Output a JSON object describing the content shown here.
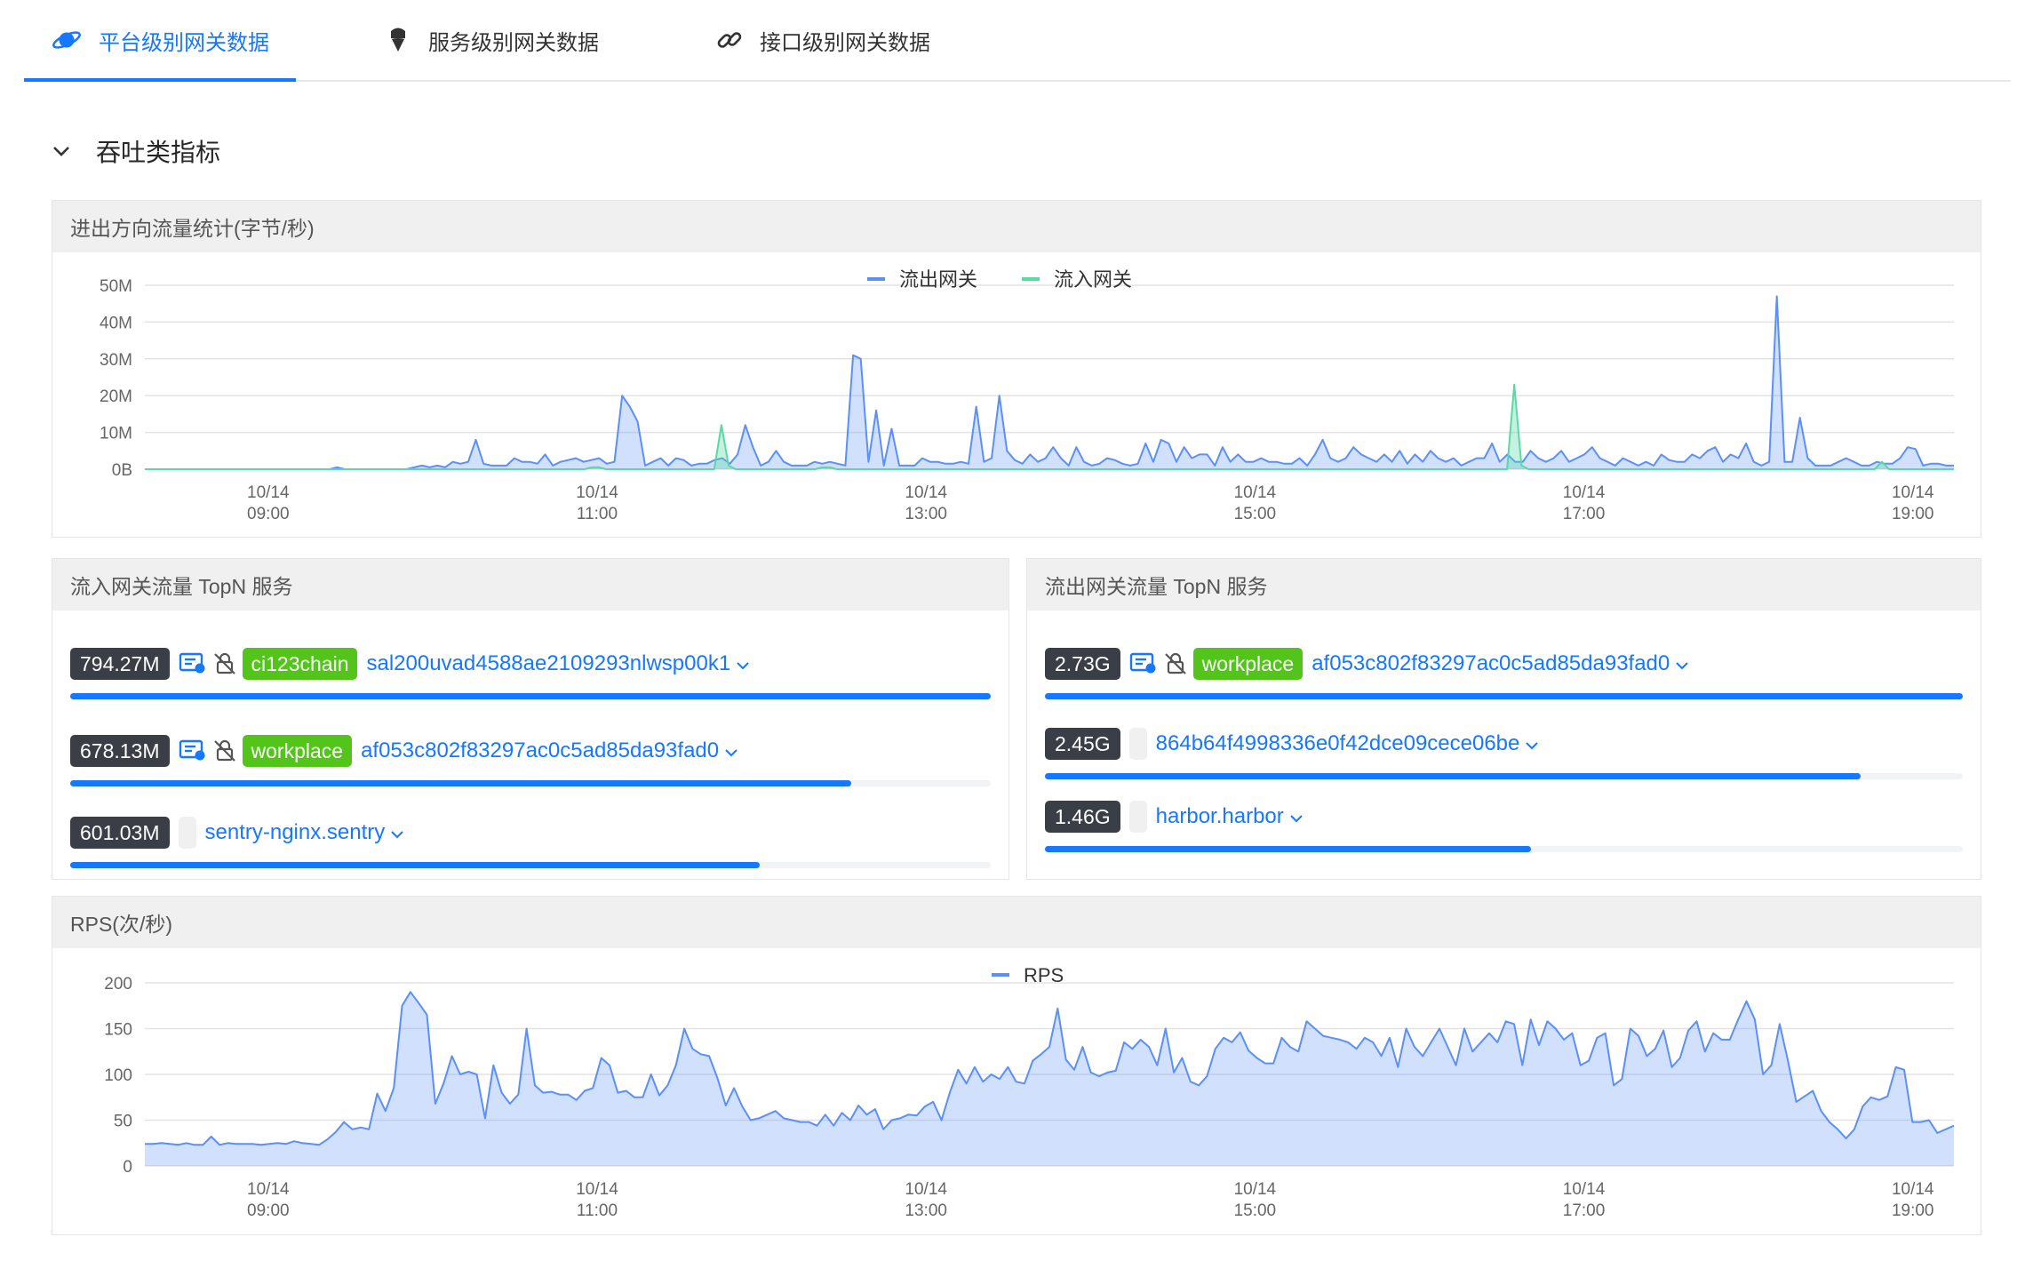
{
  "tabs": [
    {
      "label": "平台级别网关数据",
      "icon": "planet-icon",
      "active": true
    },
    {
      "label": "服务级别网关数据",
      "icon": "ice-cream-icon",
      "active": false
    },
    {
      "label": "接口级别网关数据",
      "icon": "link-icon",
      "active": false
    }
  ],
  "section": {
    "title": "吞吐类指标"
  },
  "colors": {
    "accent": "#1677ff",
    "outflow": "#5b8ff9",
    "inflow": "#5ad8a6",
    "badge_bg": "#3a3f47",
    "env_tag": "#52c41a"
  },
  "traffic_panel": {
    "title": "进出方向流量统计(字节/秒)"
  },
  "in_topn": {
    "title": "流入网关流量 TopN 服务",
    "items": [
      {
        "value": "794.27M",
        "env": "ci123chain",
        "service": "sal200uvad4588ae2109293nlwsp00k1",
        "ratio": 1.0,
        "icons": true
      },
      {
        "value": "678.13M",
        "env": "workplace",
        "service": "af053c802f83297ac0c5ad85da93fad0",
        "ratio": 0.848,
        "icons": true
      },
      {
        "value": "601.03M",
        "env": "",
        "service": "sentry-nginx.sentry",
        "ratio": 0.749,
        "icons": false
      }
    ]
  },
  "out_topn": {
    "title": "流出网关流量 TopN 服务",
    "items": [
      {
        "value": "2.73G",
        "env": "workplace",
        "service": "af053c802f83297ac0c5ad85da93fad0",
        "ratio": 1.0,
        "icons": true
      },
      {
        "value": "2.45G",
        "env": "",
        "service": "864b64f4998336e0f42dce09cece06be",
        "ratio": 0.889,
        "icons": false
      },
      {
        "value": "1.46G",
        "env": "",
        "service": "harbor.harbor",
        "ratio": 0.53,
        "icons": false
      }
    ]
  },
  "rps_panel": {
    "title": "RPS(次/秒)"
  },
  "chart_data": [
    {
      "type": "area",
      "title": "进出方向流量统计(字节/秒)",
      "x_range": [
        "08:15",
        "19:15"
      ],
      "x_ticks": [
        [
          "10/14",
          "09:00"
        ],
        [
          "10/14",
          "11:00"
        ],
        [
          "10/14",
          "13:00"
        ],
        [
          "10/14",
          "15:00"
        ],
        [
          "10/14",
          "17:00"
        ],
        [
          "10/14",
          "19:00"
        ]
      ],
      "y_ticks": [
        "0B",
        "10M",
        "20M",
        "30M",
        "40M",
        "50M"
      ],
      "ylim": [
        0,
        50
      ],
      "y_unit": "M",
      "legend": "top-center",
      "grid": true,
      "series": [
        {
          "name": "流出网关",
          "color": "#5b8ff9",
          "values": [
            0,
            0,
            0,
            0,
            0,
            0,
            0,
            0,
            0,
            0,
            0,
            0,
            0,
            0,
            0,
            0,
            0,
            0,
            0,
            0,
            0,
            0,
            0,
            0,
            0,
            0.5,
            0,
            0,
            0,
            0,
            0,
            0,
            0,
            0,
            0,
            0.5,
            1,
            0.5,
            1,
            0.5,
            2,
            1.5,
            2,
            8,
            1.5,
            1,
            1,
            1,
            3,
            2,
            2,
            1.5,
            4,
            1,
            2,
            2.5,
            3,
            2,
            2.5,
            3,
            1.5,
            2,
            20,
            17,
            13,
            1,
            2,
            3,
            1,
            3,
            2.5,
            1,
            1.5,
            1.5,
            2.5,
            3,
            1.5,
            4,
            12,
            6,
            1,
            2,
            5,
            2,
            1,
            1,
            1,
            2,
            1.5,
            2,
            1.5,
            1,
            31,
            30,
            2,
            16,
            1,
            11,
            1,
            1,
            1,
            3,
            2,
            2,
            1.5,
            1.5,
            2,
            1.5,
            17,
            2,
            3,
            20,
            5,
            2.5,
            1.5,
            4,
            2,
            3,
            6,
            3,
            1,
            6,
            2,
            1,
            1.5,
            3,
            2.5,
            1.5,
            1,
            1.5,
            7,
            2,
            8,
            7,
            2,
            6,
            3,
            4,
            4,
            1,
            6,
            2,
            4,
            2,
            2,
            3,
            2,
            2,
            1.5,
            1.5,
            3,
            1,
            4,
            8,
            3,
            2,
            3,
            6,
            4,
            3,
            2,
            4,
            2,
            5,
            1.5,
            4,
            2,
            5,
            3,
            2,
            3,
            1,
            2,
            3,
            3,
            7,
            2,
            4,
            2,
            2,
            5,
            3,
            2,
            3,
            5,
            2,
            3,
            4,
            6,
            3,
            2,
            1,
            3,
            2,
            1,
            2,
            1,
            4,
            2.5,
            2,
            2,
            4,
            3,
            5,
            6,
            2,
            4,
            3,
            7,
            2,
            1,
            2,
            47,
            2,
            2,
            14,
            3,
            1,
            1,
            1,
            2,
            3,
            2,
            1,
            1,
            2,
            1.5,
            1.5,
            3,
            6,
            5.5,
            1,
            1.5,
            1.5,
            1,
            1
          ]
        },
        {
          "name": "流入网关",
          "color": "#5ad8a6",
          "values": [
            0,
            0,
            0,
            0,
            0,
            0,
            0,
            0,
            0,
            0,
            0,
            0,
            0,
            0,
            0,
            0,
            0,
            0,
            0,
            0,
            0,
            0,
            0,
            0,
            0,
            0,
            0,
            0,
            0,
            0,
            0,
            0,
            0,
            0,
            0,
            0,
            0,
            0,
            0,
            0,
            0,
            0,
            0,
            0,
            0,
            0,
            0,
            0,
            0,
            0,
            0,
            0,
            0,
            0,
            0,
            0,
            0,
            0,
            0,
            0,
            0,
            0,
            0.5,
            0.5,
            0,
            0,
            0,
            0,
            0,
            0,
            0,
            0,
            0,
            0,
            0,
            0,
            0,
            0,
            0,
            0,
            12,
            1,
            0,
            0,
            0,
            0,
            0,
            0,
            0,
            0,
            0,
            0,
            0,
            0,
            0.5,
            0.5,
            0,
            0,
            0,
            0,
            0,
            0,
            0,
            0,
            0,
            0,
            0,
            0,
            0,
            0,
            0,
            0,
            0,
            0,
            0,
            0,
            0,
            0,
            0,
            0,
            0,
            0,
            0,
            0,
            0,
            0,
            0,
            0,
            0,
            0,
            0,
            0,
            0,
            0,
            0,
            0,
            0,
            0,
            0,
            0,
            0,
            0,
            0,
            0,
            0,
            0,
            0,
            0,
            0,
            0,
            0,
            0,
            0,
            0,
            0,
            0,
            0,
            0,
            0,
            0,
            0,
            0,
            0,
            0,
            0,
            0,
            0,
            0,
            0,
            0,
            0,
            0,
            0,
            0,
            0,
            0,
            0,
            0,
            0,
            0,
            0,
            0,
            0,
            0,
            0,
            0,
            0,
            0,
            0,
            0,
            23,
            1,
            0,
            0,
            0,
            0,
            0,
            0,
            0,
            0,
            0,
            0,
            0,
            0,
            0,
            0,
            0,
            0,
            0,
            0,
            0,
            0,
            0,
            0,
            0,
            0,
            0,
            0,
            0,
            0,
            0,
            0,
            0,
            0,
            0,
            0,
            0,
            0,
            0,
            0,
            0,
            0,
            0,
            0,
            0,
            0,
            0,
            0,
            0,
            0,
            0,
            2,
            0,
            0,
            0,
            0,
            0,
            0,
            0,
            0,
            0,
            0
          ]
        }
      ]
    },
    {
      "type": "area",
      "title": "RPS(次/秒)",
      "x_range": [
        "08:15",
        "19:15"
      ],
      "x_ticks": [
        [
          "10/14",
          "09:00"
        ],
        [
          "10/14",
          "11:00"
        ],
        [
          "10/14",
          "13:00"
        ],
        [
          "10/14",
          "15:00"
        ],
        [
          "10/14",
          "17:00"
        ],
        [
          "10/14",
          "19:00"
        ]
      ],
      "y_ticks": [
        "0",
        "50",
        "100",
        "150",
        "200"
      ],
      "ylim": [
        0,
        200
      ],
      "legend": "top-center",
      "grid": true,
      "series": [
        {
          "name": "RPS",
          "color": "#5b8ff9",
          "values": [
            24,
            24,
            25,
            24,
            23,
            25,
            23,
            23,
            32,
            23,
            25,
            24,
            24,
            24,
            23,
            24,
            25,
            24,
            27,
            25,
            24,
            23,
            29,
            37,
            48,
            40,
            42,
            40,
            79,
            60,
            85,
            175,
            190,
            178,
            165,
            68,
            90,
            120,
            100,
            103,
            100,
            52,
            110,
            80,
            68,
            78,
            150,
            88,
            80,
            81,
            78,
            78,
            72,
            82,
            85,
            118,
            110,
            80,
            82,
            75,
            75,
            100,
            77,
            88,
            110,
            150,
            128,
            122,
            120,
            96,
            66,
            85,
            65,
            50,
            52,
            56,
            60,
            52,
            50,
            48,
            48,
            44,
            56,
            44,
            58,
            50,
            66,
            56,
            62,
            40,
            50,
            52,
            56,
            55,
            65,
            70,
            50,
            80,
            105,
            90,
            108,
            92,
            100,
            95,
            108,
            92,
            90,
            115,
            122,
            130,
            172,
            116,
            105,
            130,
            102,
            98,
            102,
            104,
            135,
            128,
            138,
            130,
            110,
            150,
            102,
            118,
            92,
            88,
            98,
            128,
            140,
            135,
            146,
            126,
            118,
            112,
            112,
            140,
            130,
            125,
            158,
            150,
            142,
            140,
            138,
            135,
            128,
            140,
            135,
            120,
            140,
            108,
            150,
            130,
            120,
            135,
            150,
            130,
            110,
            150,
            125,
            135,
            145,
            135,
            158,
            155,
            110,
            160,
            132,
            158,
            150,
            138,
            145,
            110,
            115,
            140,
            145,
            88,
            95,
            150,
            142,
            120,
            128,
            148,
            108,
            118,
            148,
            158,
            125,
            145,
            138,
            138,
            160,
            180,
            160,
            100,
            110,
            155,
            115,
            70,
            76,
            82,
            60,
            48,
            40,
            30,
            40,
            65,
            75,
            72,
            76,
            108,
            105,
            48,
            48,
            50,
            36,
            40,
            44
          ]
        }
      ]
    }
  ]
}
